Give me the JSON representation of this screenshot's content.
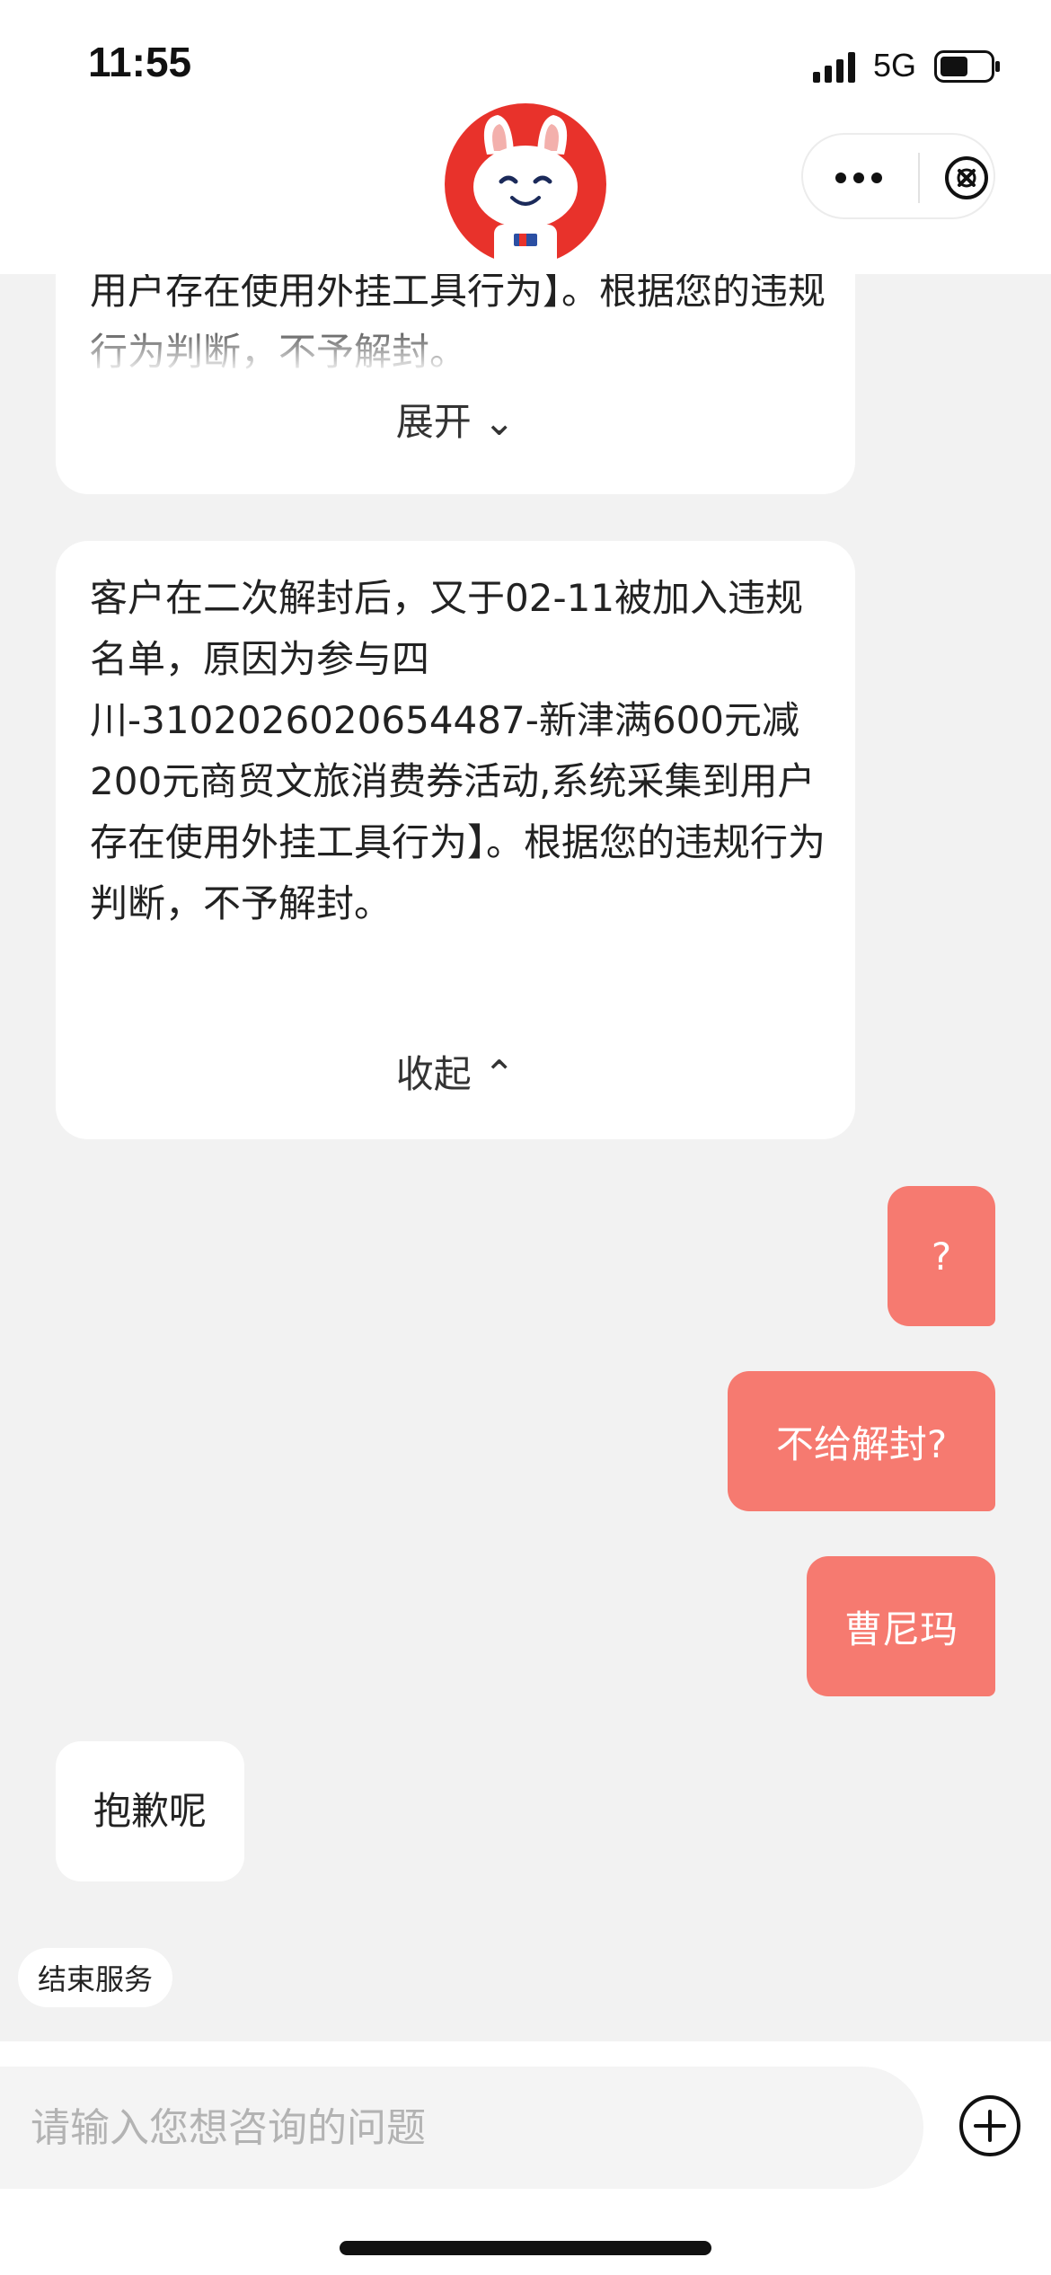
{
  "status_bar": {
    "time": "11:55",
    "network": "5G"
  },
  "colors": {
    "accent": "#f67a70",
    "background": "#f2f2f2",
    "bubble": "#ffffff"
  },
  "header": {
    "avatar_icon": "mascot-avatar-icon",
    "more_icon": "more-dots-icon",
    "close_icon": "close-circle-icon"
  },
  "messages": {
    "collapsed_card": {
      "text": "用户存在使用外挂工具行为】。根据您的违规行为判断，不予解封。",
      "toggle_label": "展开 ⌄"
    },
    "expanded_card": {
      "text": "客户在二次解封后，又于02-11被加入违规名单，原因为参与四川-3102026020654487-新津满600元减200元商贸文旅消费券活动,系统采集到用户存在使用外挂工具行为】。根据您的违规行为判断，不予解封。",
      "toggle_label": "收起 ⌃"
    },
    "user_1": "?",
    "user_2": "不给解封?",
    "user_3": "曹尼玛",
    "bot_reply": "抱歉呢"
  },
  "actions": {
    "end_service": "结束服务"
  },
  "input": {
    "placeholder": "请输入您想咨询的问题",
    "plus_icon": "plus-circle-icon"
  }
}
